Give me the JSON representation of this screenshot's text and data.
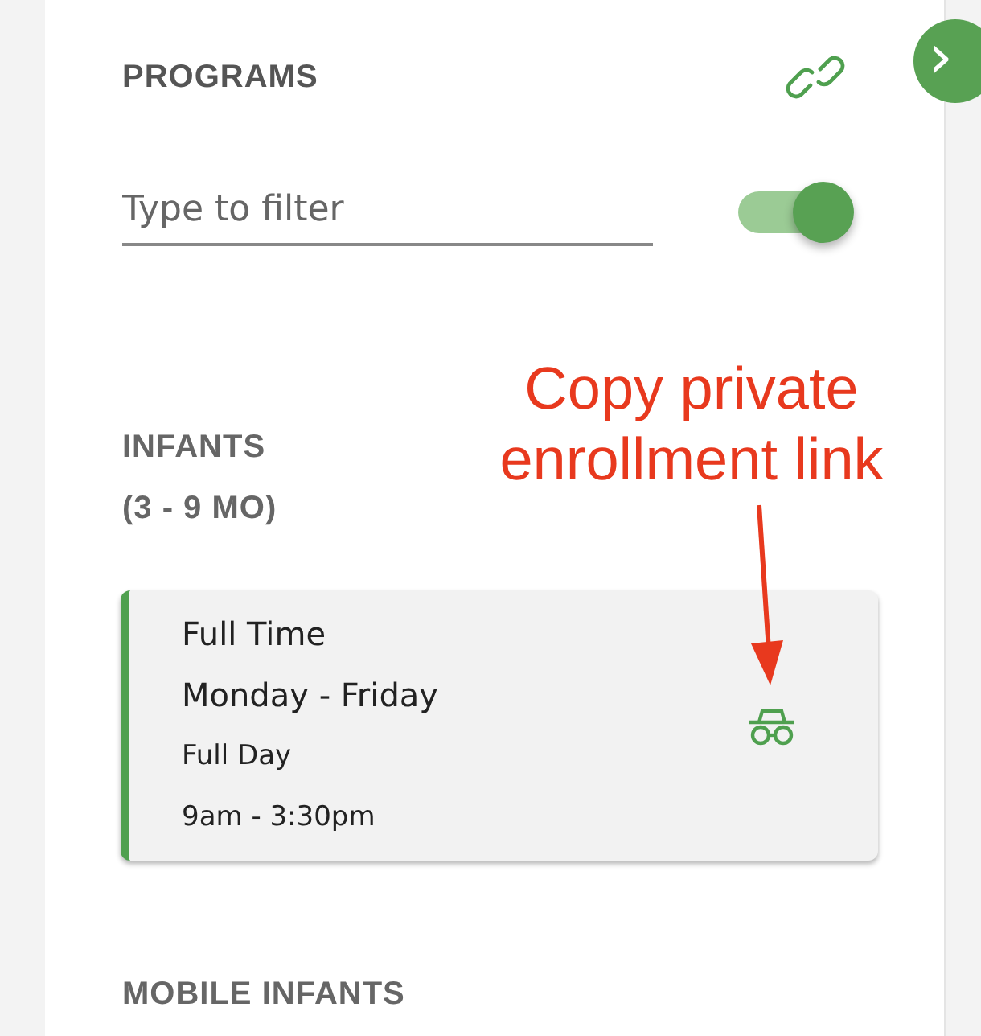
{
  "panel": {
    "title": "PROGRAMS",
    "expand_button": {
      "label": "›"
    }
  },
  "filter": {
    "placeholder": "Type to filter",
    "toggle": {
      "on": true
    }
  },
  "sections": [
    {
      "name": "INFANTS",
      "subtitle": "(3 - 9 MO)",
      "programs": [
        {
          "title": "Full Time",
          "days": "Monday - Friday",
          "session": "Full Day",
          "hours": "9am - 3:30pm",
          "color": "#4fa04f"
        }
      ]
    },
    {
      "name": "MOBILE INFANTS"
    }
  ],
  "annotation": {
    "text": "Copy private enrollment link"
  }
}
